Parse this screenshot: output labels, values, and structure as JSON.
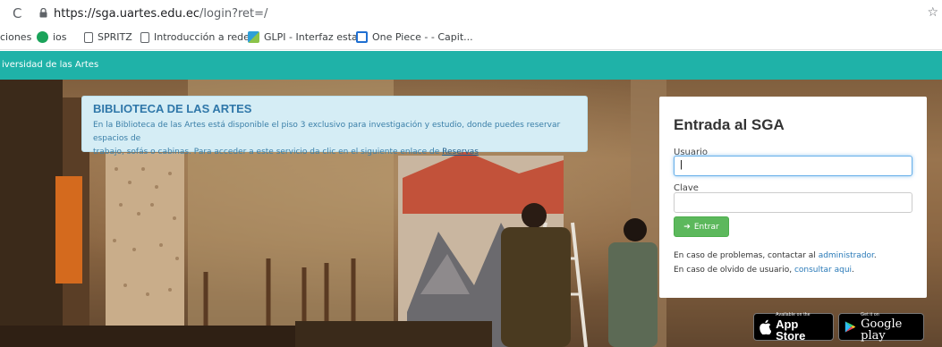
{
  "browser": {
    "reload_icon": "reload-icon",
    "url_host": "https://sga.uartes.edu.ec",
    "url_path": "/login?ret=/",
    "bookmarks": [
      {
        "label": "ciones",
        "icon": "none"
      },
      {
        "label": "ios",
        "icon": "green-circle-icon"
      },
      {
        "label": "SPRITZ",
        "icon": "doc-icon"
      },
      {
        "label": "Introducción a redes",
        "icon": "doc-icon"
      },
      {
        "label": "GLPI - Interfaz esta...",
        "icon": "glpi-icon"
      },
      {
        "label": "One Piece - - Capit...",
        "icon": "onepiece-icon"
      }
    ]
  },
  "site": {
    "header": "iversidad de las Artes"
  },
  "info": {
    "title": "BIBLIOTECA DE LAS ARTES",
    "line1": "En la Biblioteca de las Artes está disponible el piso 3 exclusivo para investigación y estudio, donde puedes reservar espacios de",
    "line2": "trabajo, sofás o cabinas. Para acceder a este servicio da clic en el siguiente enlace de ",
    "link": "Reservas"
  },
  "login": {
    "title": "Entrada al SGA",
    "user_label": "Usuario",
    "user_value": "|",
    "pass_label": "Clave",
    "pass_value": "",
    "submit": "Entrar",
    "help1_text": "En caso de problemas, contactar al ",
    "help1_link": "administrador",
    "help1_end": ".",
    "help2_text": "En caso de olvido de usuario, ",
    "help2_link": "consultar aqui",
    "help2_end": "."
  },
  "badges": {
    "appstore_small": "Available on the",
    "appstore_big": "App Store",
    "google_small": "Get it on",
    "google_big": "Google play"
  },
  "colors": {
    "teal": "#1fb2a8",
    "info_bg": "#d5edf5",
    "button_green": "#5cb85c",
    "link_blue": "#2a7ab8"
  }
}
